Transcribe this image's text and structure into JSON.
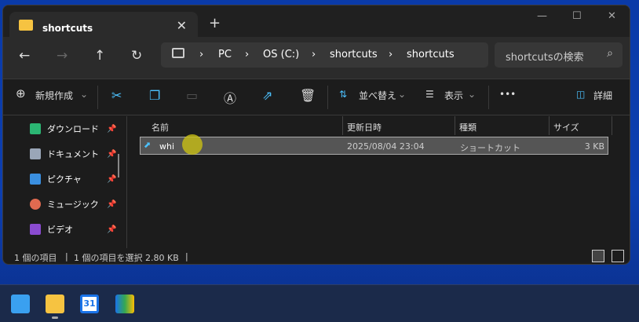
{
  "tab": {
    "title": "shortcuts",
    "close": "✕",
    "new": "+"
  },
  "window_controls": {
    "minimize": "—",
    "maximize": "☐",
    "close": "✕"
  },
  "nav": {
    "back": "←",
    "forward": "→",
    "up": "↑",
    "refresh": "↻"
  },
  "breadcrumb": [
    "PC",
    "OS (C:)",
    "shortcuts",
    "shortcuts"
  ],
  "breadcrumb_sep": "›",
  "search": {
    "placeholder": "shortcutsの検索",
    "icon": "⌕"
  },
  "toolbar": {
    "new": "新規作成",
    "sort": "並べ替え",
    "view": "表示",
    "more": "•••",
    "details": "詳細"
  },
  "sidebar": [
    {
      "label": "ダウンロード",
      "color": "#2bb673"
    },
    {
      "label": "ドキュメント",
      "color": "#9aa6b8"
    },
    {
      "label": "ピクチャ",
      "color": "#3a8fe0"
    },
    {
      "label": "ミュージック",
      "color": "#e06a50"
    },
    {
      "label": "ビデオ",
      "color": "#8a4bd0"
    }
  ],
  "columns": {
    "name": "名前",
    "modified": "更新日時",
    "type": "種類",
    "size": "サイズ"
  },
  "files": [
    {
      "name": "whi",
      "modified": "2025/08/04 23:04",
      "type": "ショートカット",
      "size": "3 KB"
    }
  ],
  "status": {
    "count": "1 個の項目",
    "selected": "1 個の項目を選択  2.80 KB"
  }
}
